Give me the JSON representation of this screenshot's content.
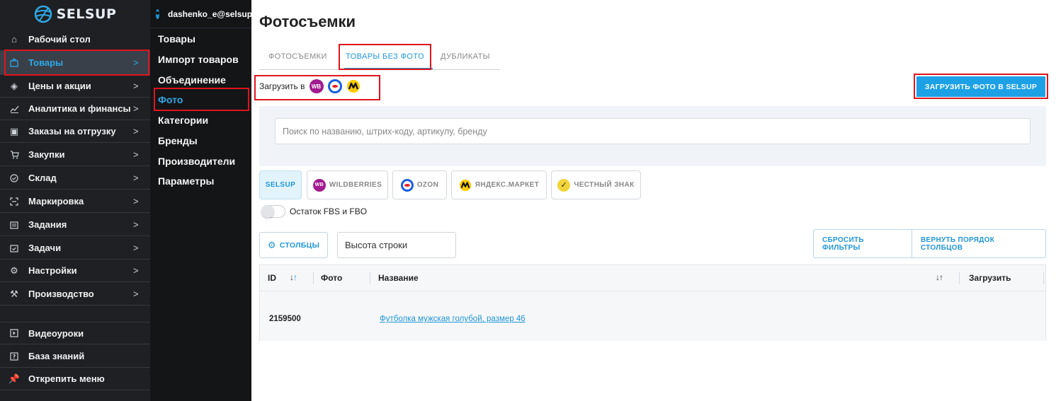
{
  "brand": {
    "logo_text": "SELSUP",
    "accent": "#1da1e6",
    "highlight": "#e0141c"
  },
  "sidebar": {
    "items": [
      {
        "label": "Рабочий стол",
        "icon": "home-icon",
        "has_chevron": false
      },
      {
        "label": "Товары",
        "icon": "bag-icon",
        "has_chevron": true,
        "active": true
      },
      {
        "label": "Цены и акции",
        "icon": "tag-icon",
        "has_chevron": true
      },
      {
        "label": "Аналитика и финансы",
        "icon": "chart-line-icon",
        "has_chevron": true
      },
      {
        "label": "Заказы на отгрузку",
        "icon": "box-icon",
        "has_chevron": true
      },
      {
        "label": "Закупки",
        "icon": "cart-icon",
        "has_chevron": true
      },
      {
        "label": "Склад",
        "icon": "check-circle-icon",
        "has_chevron": true
      },
      {
        "label": "Маркировка",
        "icon": "scan-icon",
        "has_chevron": true
      },
      {
        "label": "Задания",
        "icon": "calendar-icon",
        "has_chevron": true
      },
      {
        "label": "Задачи",
        "icon": "task-icon",
        "has_chevron": true
      },
      {
        "label": "Настройки",
        "icon": "gear-icon",
        "has_chevron": true
      },
      {
        "label": "Производство",
        "icon": "factory-icon",
        "has_chevron": true
      }
    ],
    "bottom_items": [
      {
        "label": "Видеоуроки",
        "icon": "play-icon"
      },
      {
        "label": "База знаний",
        "icon": "question-icon"
      },
      {
        "label": "Открепить меню",
        "icon": "pin-icon"
      }
    ]
  },
  "submenu": {
    "user": "dashenko_e@selsup",
    "items": [
      "Товары",
      "Импорт товаров",
      "Объединение",
      "Фото",
      "Категории",
      "Бренды",
      "Производители",
      "Параметры"
    ],
    "active_index": 3
  },
  "main": {
    "title": "Фотосъемки",
    "tabs": [
      "ФОТОСЪЕМКИ",
      "ТОВАРЫ БЕЗ ФОТО",
      "ДУБЛИКАТЫ"
    ],
    "active_tab": 1,
    "upload_in_label": "Загрузить в",
    "upload_targets": [
      "WB",
      "Ozon",
      "Яндекс.Маркет"
    ],
    "upload_button": "ЗАГРУЗИТЬ ФОТО В SELSUP",
    "search_placeholder": "Поиск по названию, штрих-коду, артикулу, бренду",
    "marketplaces": [
      {
        "label": "SELSUP",
        "active": true
      },
      {
        "label": "WILDBERRIES",
        "icon": "WB"
      },
      {
        "label": "OZON"
      },
      {
        "label": "ЯНДЕКС.МАРКЕТ"
      },
      {
        "label": "ЧЕСТНЫЙ ЗНАК"
      }
    ],
    "toggle_label": "Остаток FBS и FBO",
    "toggle_on": false,
    "columns_button": "СТОЛБЦЫ",
    "row_height_label": "Высота строки",
    "reset_filters": "СБРОСИТЬ ФИЛЬТРЫ",
    "restore_columns": "ВЕРНУТЬ ПОРЯДОК СТОЛБЦОВ",
    "table": {
      "columns": [
        "ID",
        "Фото",
        "Название",
        "Загрузить"
      ],
      "rows": [
        {
          "id": "2159500",
          "name": "Футболка мужская голубой, размер 46"
        }
      ]
    }
  }
}
